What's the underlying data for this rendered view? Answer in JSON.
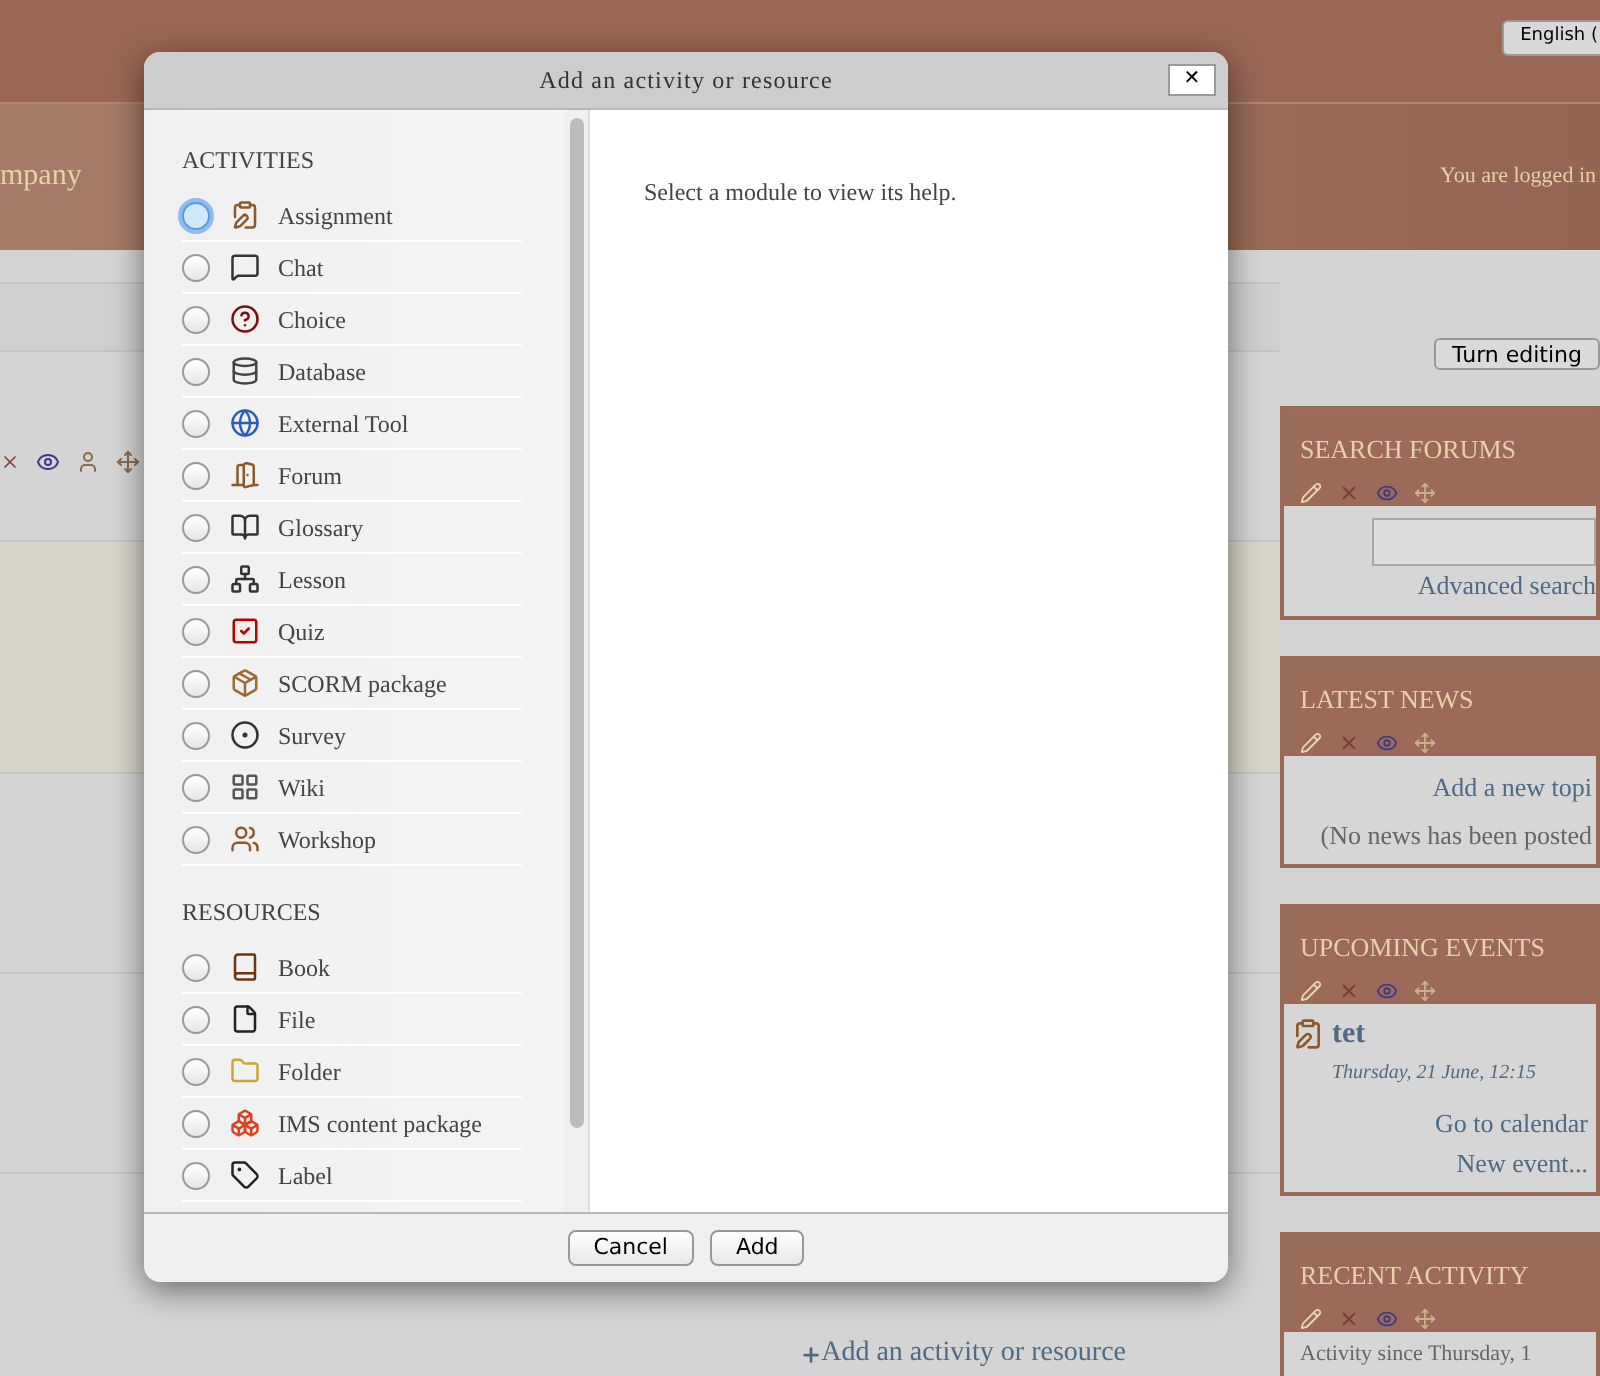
{
  "page": {
    "language_button": "English (",
    "site_name": "mpany",
    "login_info": "You are logged in",
    "editing_button": "Turn editing",
    "add_link": "Add an activity or resource"
  },
  "blocks": [
    {
      "kind": "search",
      "title": "SEARCH FORUMS",
      "link": "Advanced search"
    },
    {
      "kind": "news",
      "title": "LATEST NEWS",
      "link": "Add a new topi",
      "note": "(No news has been posted"
    },
    {
      "kind": "events",
      "title": "UPCOMING EVENTS",
      "event_title": "tet",
      "event_date": "Thursday, 21 June, 12:15",
      "links": [
        "Go to calendar",
        "New event..."
      ]
    },
    {
      "kind": "recent",
      "title": "RECENT ACTIVITY",
      "note": "Activity since Thursday, 1"
    }
  ],
  "dialog": {
    "title": "Add an activity or resource",
    "close": "✕",
    "help_text": "Select a module to view its help.",
    "sections": [
      {
        "heading": "ACTIVITIES",
        "items": [
          {
            "label": "Assignment",
            "selected": false,
            "focused": true
          },
          {
            "label": "Chat",
            "selected": false,
            "focused": false
          },
          {
            "label": "Choice",
            "selected": false,
            "focused": false
          },
          {
            "label": "Database",
            "selected": false,
            "focused": false
          },
          {
            "label": "External Tool",
            "selected": false,
            "focused": false
          },
          {
            "label": "Forum",
            "selected": false,
            "focused": false
          },
          {
            "label": "Glossary",
            "selected": false,
            "focused": false
          },
          {
            "label": "Lesson",
            "selected": false,
            "focused": false
          },
          {
            "label": "Quiz",
            "selected": false,
            "focused": false
          },
          {
            "label": "SCORM package",
            "selected": false,
            "focused": false
          },
          {
            "label": "Survey",
            "selected": false,
            "focused": false
          },
          {
            "label": "Wiki",
            "selected": false,
            "focused": false
          },
          {
            "label": "Workshop",
            "selected": false,
            "focused": false
          }
        ]
      },
      {
        "heading": "RESOURCES",
        "items": [
          {
            "label": "Book",
            "selected": false,
            "focused": false
          },
          {
            "label": "File",
            "selected": false,
            "focused": false
          },
          {
            "label": "Folder",
            "selected": false,
            "focused": false
          },
          {
            "label": "IMS content package",
            "selected": false,
            "focused": false
          },
          {
            "label": "Label",
            "selected": false,
            "focused": false
          }
        ]
      }
    ],
    "buttons": [
      "Cancel",
      "Add"
    ]
  }
}
